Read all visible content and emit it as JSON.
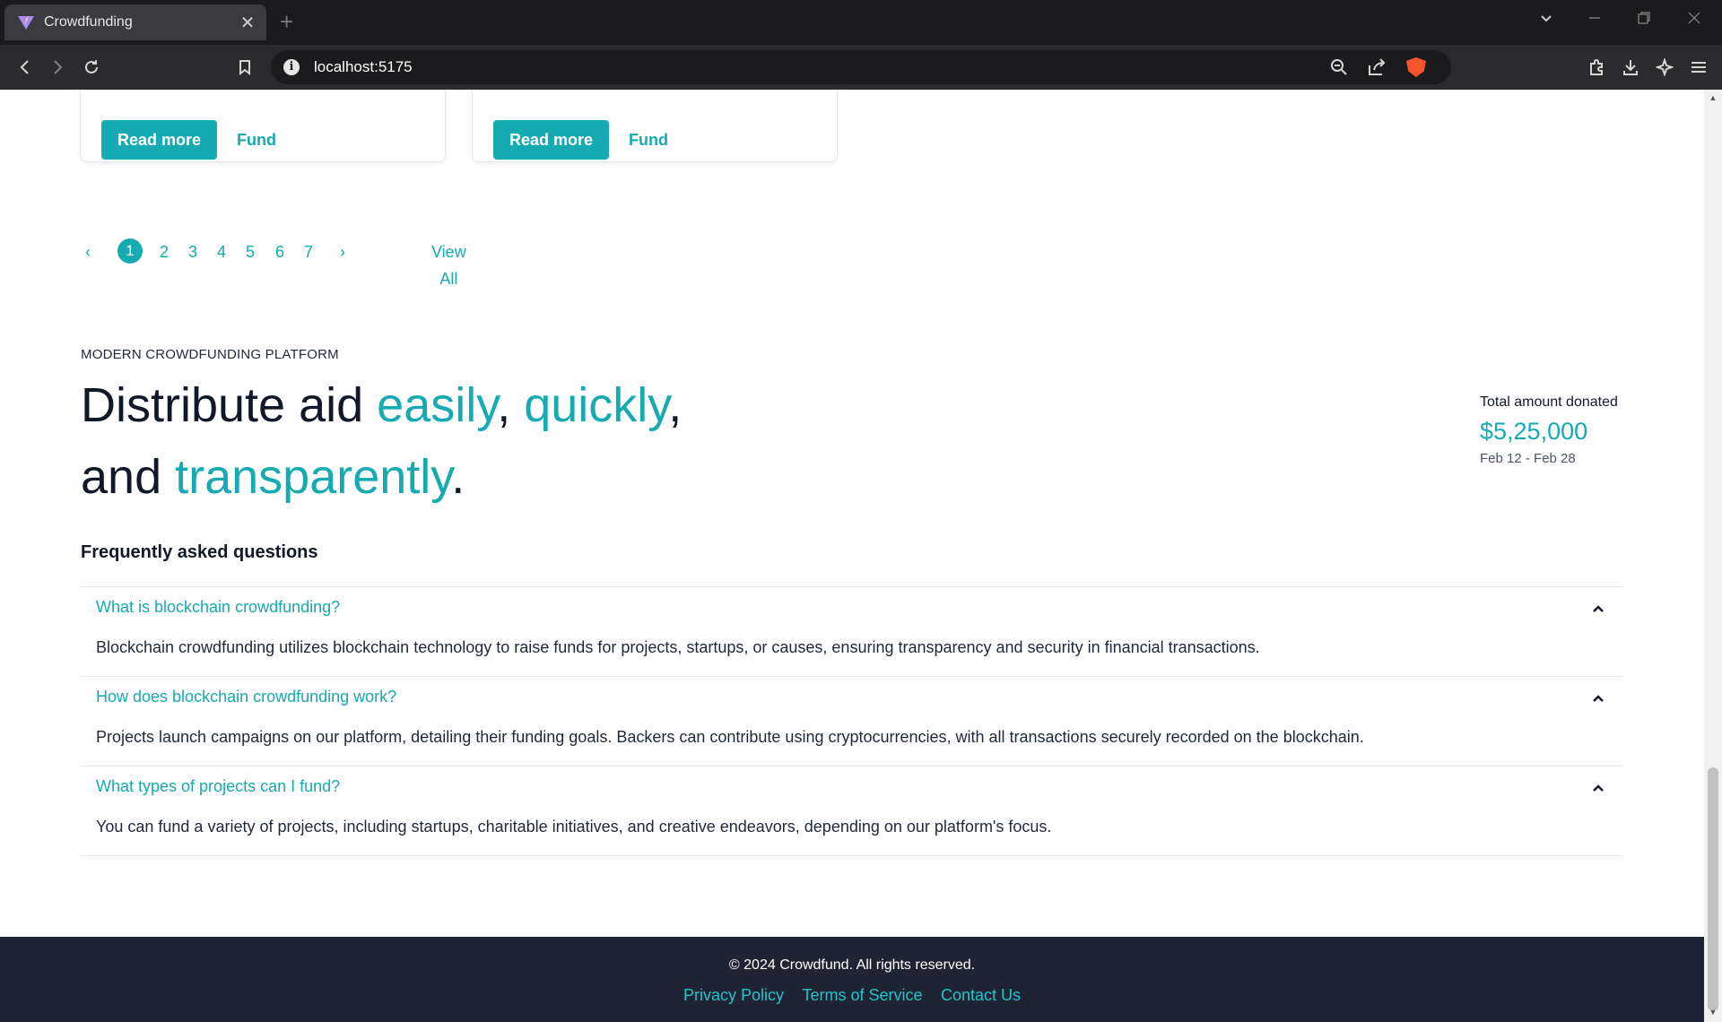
{
  "browser": {
    "tab_title": "Crowdfunding",
    "new_tab_glyph": "+",
    "url": "localhost:5175",
    "address_info_glyph": "i"
  },
  "cards": [
    {
      "read_more_label": "Read more",
      "fund_label": "Fund"
    },
    {
      "read_more_label": "Read more",
      "fund_label": "Fund"
    }
  ],
  "pagination": {
    "prev_glyph": "‹",
    "next_glyph": "›",
    "pages": [
      "1",
      "2",
      "3",
      "4",
      "5",
      "6",
      "7"
    ],
    "active_page": "1",
    "view_all_label": "View All"
  },
  "hero": {
    "eyebrow": "MODERN CROWDFUNDING PLATFORM",
    "part1": "Distribute aid ",
    "accent1": "easily",
    "sep1": ", ",
    "accent2": "quickly",
    "sep2": ",",
    "part2": "and ",
    "accent3": "transparently",
    "end": "."
  },
  "stats": {
    "label": "Total amount donated",
    "value": "$5,25,000",
    "range": "Feb 12 - Feb 28"
  },
  "faq": {
    "title": "Frequently asked questions",
    "items": [
      {
        "question": "What is blockchain crowdfunding?",
        "answer": "Blockchain crowdfunding utilizes blockchain technology to raise funds for projects, startups, or causes, ensuring transparency and security in financial transactions."
      },
      {
        "question": "How does blockchain crowdfunding work?",
        "answer": "Projects launch campaigns on our platform, detailing their funding goals. Backers can contribute using cryptocurrencies, with all transactions securely recorded on the blockchain."
      },
      {
        "question": "What types of projects can I fund?",
        "answer": "You can fund a variety of projects, including startups, charitable initiatives, and creative endeavors, depending on our platform's focus."
      }
    ]
  },
  "footer": {
    "copyright": "© 2024 Crowdfund. All rights reserved.",
    "links": [
      "Privacy Policy",
      "Terms of Service",
      "Contact Us"
    ]
  },
  "colors": {
    "accent": "#16aab2",
    "footer_bg": "#1e2433",
    "footer_link": "#22c3ca"
  }
}
